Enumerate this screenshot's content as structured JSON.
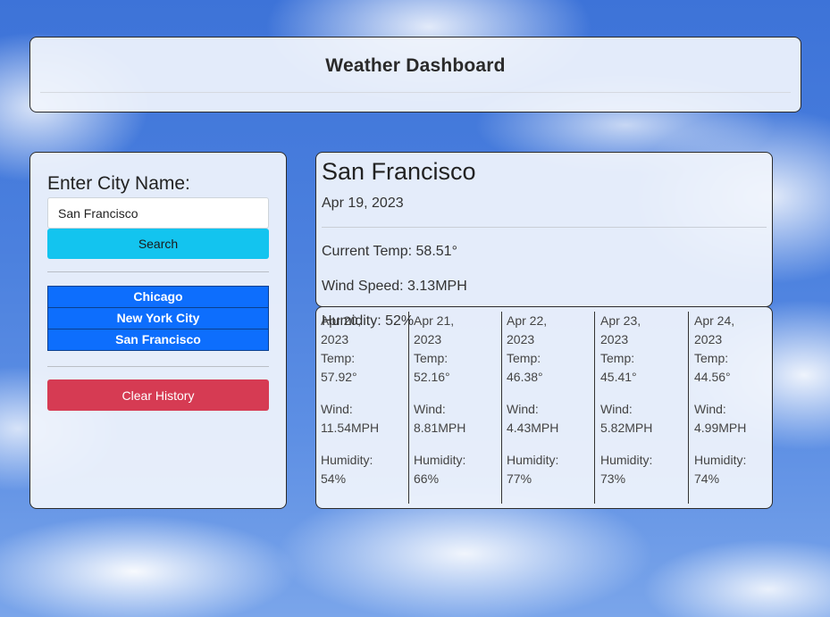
{
  "header": {
    "title": "Weather Dashboard"
  },
  "search": {
    "label": "Enter City Name:",
    "input_value": "San Francisco",
    "button_label": "Search"
  },
  "history": [
    "Chicago",
    "New York City",
    "San Francisco"
  ],
  "clear_label": "Clear History",
  "current": {
    "city": "San Francisco",
    "date": "Apr 19, 2023",
    "temp": "Current Temp: 58.51°",
    "wind": "Wind Speed: 3.13MPH",
    "humidity": "Humidity: 52%"
  },
  "forecast": [
    {
      "date_line1": "Apr 20,",
      "date_line2": "2023",
      "temp_label": "Temp:",
      "temp": "57.92°",
      "wind_label": "Wind:",
      "wind": "11.54MPH",
      "humidity_label": "Humidity:",
      "humidity": "54%"
    },
    {
      "date_line1": "Apr 21,",
      "date_line2": "2023",
      "temp_label": "Temp:",
      "temp": "52.16°",
      "wind_label": "Wind:",
      "wind": "8.81MPH",
      "humidity_label": "Humidity:",
      "humidity": "66%"
    },
    {
      "date_line1": "Apr 22,",
      "date_line2": "2023",
      "temp_label": "Temp:",
      "temp": "46.38°",
      "wind_label": "Wind:",
      "wind": "4.43MPH",
      "humidity_label": "Humidity:",
      "humidity": "77%"
    },
    {
      "date_line1": "Apr 23,",
      "date_line2": "2023",
      "temp_label": "Temp:",
      "temp": "45.41°",
      "wind_label": "Wind:",
      "wind": "5.82MPH",
      "humidity_label": "Humidity:",
      "humidity": "73%"
    },
    {
      "date_line1": "Apr 24,",
      "date_line2": "2023",
      "temp_label": "Temp:",
      "temp": "44.56°",
      "wind_label": "Wind:",
      "wind": "4.99MPH",
      "humidity_label": "Humidity:",
      "humidity": "74%"
    }
  ],
  "colors": {
    "search_button": "#13c4ef",
    "history_button": "#0d6efd",
    "clear_button": "#d63b53"
  }
}
